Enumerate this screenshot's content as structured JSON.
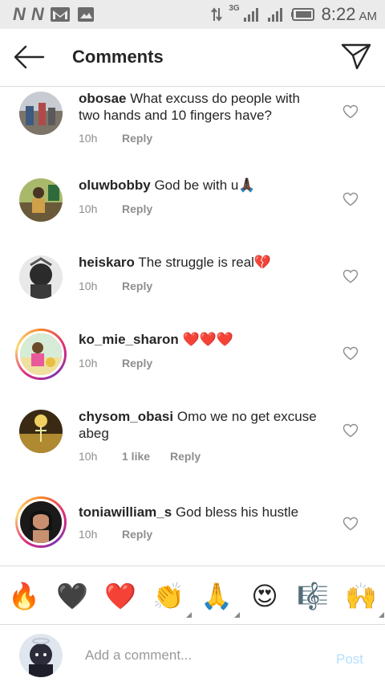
{
  "status_bar": {
    "network_label": "3G",
    "time": "8:22",
    "ampm": "AM",
    "notif_letter_1": "N",
    "notif_letter_2": "N"
  },
  "header": {
    "title": "Comments"
  },
  "comments": [
    {
      "username": "obosae",
      "text": "What excuss do people with two hands and 10 fingers have?",
      "time": "10h",
      "likes": "",
      "reply": "Reply",
      "story_ring": false
    },
    {
      "username": "oluwbobby",
      "text": "God be with u🙏🏿",
      "time": "10h",
      "likes": "",
      "reply": "Reply",
      "story_ring": false
    },
    {
      "username": "heiskaro",
      "text": "The struggle is real💔",
      "time": "10h",
      "likes": "",
      "reply": "Reply",
      "story_ring": false
    },
    {
      "username": "ko_mie_sharon",
      "text": "❤️❤️❤️",
      "time": "10h",
      "likes": "",
      "reply": "Reply",
      "story_ring": true
    },
    {
      "username": "chysom_obasi",
      "text": "Omo we no get excuse abeg",
      "time": "10h",
      "likes": "1 like",
      "reply": "Reply",
      "story_ring": false
    },
    {
      "username": "toniawilliam_s",
      "text": "God bless his hustle",
      "time": "10h",
      "likes": "",
      "reply": "Reply",
      "story_ring": true
    }
  ],
  "emoji_bar": [
    "🔥",
    "🖤",
    "❤️",
    "👏",
    "🙏",
    "😍",
    "🎼",
    "🙌"
  ],
  "composer": {
    "placeholder": "Add a comment...",
    "post_label": "Post"
  },
  "colors": {
    "accent_post_disabled": "#b2dffc",
    "meta_gray": "#8e8e8e",
    "divider": "#dbdbdb"
  }
}
